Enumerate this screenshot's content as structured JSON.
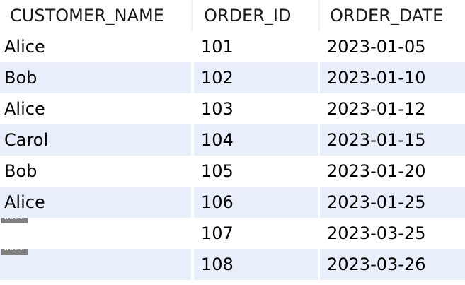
{
  "columns": [
    "CUSTOMER_NAME",
    "ORDER_ID",
    "ORDER_DATE"
  ],
  "null_label": "NULL",
  "rows": [
    {
      "customer_name": "Alice",
      "order_id": "101",
      "order_date": "2023-01-05"
    },
    {
      "customer_name": "Bob",
      "order_id": "102",
      "order_date": "2023-01-10"
    },
    {
      "customer_name": "Alice",
      "order_id": "103",
      "order_date": "2023-01-12"
    },
    {
      "customer_name": "Carol",
      "order_id": "104",
      "order_date": "2023-01-15"
    },
    {
      "customer_name": "Bob",
      "order_id": "105",
      "order_date": "2023-01-20"
    },
    {
      "customer_name": "Alice",
      "order_id": "106",
      "order_date": "2023-01-25"
    },
    {
      "customer_name": null,
      "order_id": "107",
      "order_date": "2023-03-25"
    },
    {
      "customer_name": null,
      "order_id": "108",
      "order_date": "2023-03-26"
    }
  ],
  "colors": {
    "alt_row": "#e9effa",
    "null_badge": "#808080"
  }
}
